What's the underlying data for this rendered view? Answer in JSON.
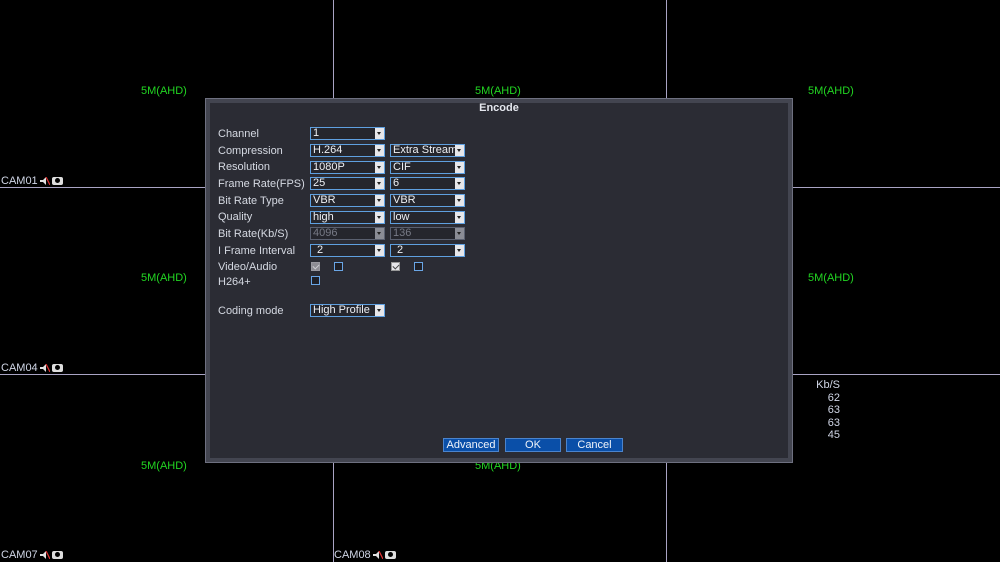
{
  "cameras": [
    {
      "res": "5M(AHD)",
      "label": ""
    },
    {
      "res": "5M(AHD)",
      "label": ""
    },
    {
      "res": "5M(AHD)",
      "label": ""
    },
    {
      "res": "5M(AHD)",
      "label": ""
    },
    {
      "res": "5M(AHD)",
      "label": ""
    },
    {
      "res": "5M(AHD)",
      "label": ""
    },
    {
      "res": "5M(AHD)",
      "label": ""
    },
    {
      "res": "5M(AHD)",
      "label": ""
    }
  ],
  "cam_labels": {
    "cam01": "CAM01",
    "cam04": "CAM04",
    "cam07": "CAM07",
    "cam08": "CAM08"
  },
  "stats": {
    "header": "Kb/S",
    "values": [
      "62",
      "63",
      "63",
      "45"
    ]
  },
  "dialog": {
    "title": "Encode",
    "labels": {
      "channel": "Channel",
      "compression": "Compression",
      "resolution": "Resolution",
      "frame_rate": "Frame Rate(FPS)",
      "bit_rate_type": "Bit Rate Type",
      "quality": "Quality",
      "bit_rate": "Bit Rate(Kb/S)",
      "i_frame_interval": "I Frame Interval",
      "video_audio": "Video/Audio",
      "h264plus": "H264+",
      "coding_mode": "Coding mode"
    },
    "main_stream": {
      "channel": "1",
      "compression": "H.264",
      "resolution": "1080P",
      "frame_rate": "25",
      "bit_rate_type": "VBR",
      "quality": "high",
      "bit_rate": "4096",
      "i_frame_interval": "2",
      "video_checked": true,
      "audio_checked": false
    },
    "extra_stream": {
      "compression": "Extra Stream",
      "resolution": "CIF",
      "frame_rate": "6",
      "bit_rate_type": "VBR",
      "quality": "low",
      "bit_rate": "136",
      "i_frame_interval": "2",
      "video_checked": true,
      "audio_checked": false
    },
    "h264plus_checked": false,
    "coding_mode": "High Profile",
    "buttons": {
      "advanced": "Advanced",
      "ok": "OK",
      "cancel": "Cancel"
    }
  }
}
